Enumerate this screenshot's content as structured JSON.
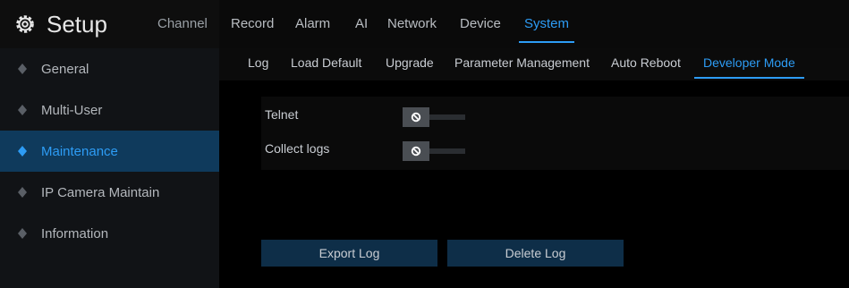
{
  "header": {
    "title": "Setup",
    "tabs": [
      {
        "label": "Channel"
      },
      {
        "label": "Record"
      },
      {
        "label": "Alarm"
      },
      {
        "label": "AI"
      },
      {
        "label": "Network"
      },
      {
        "label": "Device"
      },
      {
        "label": "System"
      }
    ],
    "active_tab": "System"
  },
  "sidebar": {
    "items": [
      {
        "label": "General"
      },
      {
        "label": "Multi-User"
      },
      {
        "label": "Maintenance"
      },
      {
        "label": "IP Camera Maintain"
      },
      {
        "label": "Information"
      }
    ],
    "active_item": "Maintenance"
  },
  "subtabs": {
    "items": [
      {
        "label": "Log"
      },
      {
        "label": "Load Default"
      },
      {
        "label": "Upgrade"
      },
      {
        "label": "Parameter Management"
      },
      {
        "label": "Auto Reboot"
      },
      {
        "label": "Developer Mode"
      }
    ],
    "active_item": "Developer Mode"
  },
  "settings": {
    "telnet": {
      "label": "Telnet",
      "enabled": false
    },
    "collect_logs": {
      "label": "Collect logs",
      "enabled": false
    }
  },
  "actions": {
    "export_log": "Export Log",
    "delete_log": "Delete Log"
  },
  "colors": {
    "accent": "#2d9cf5",
    "active_sidebar_bg": "#0f3a5c",
    "button_bg": "#0e2e48"
  }
}
